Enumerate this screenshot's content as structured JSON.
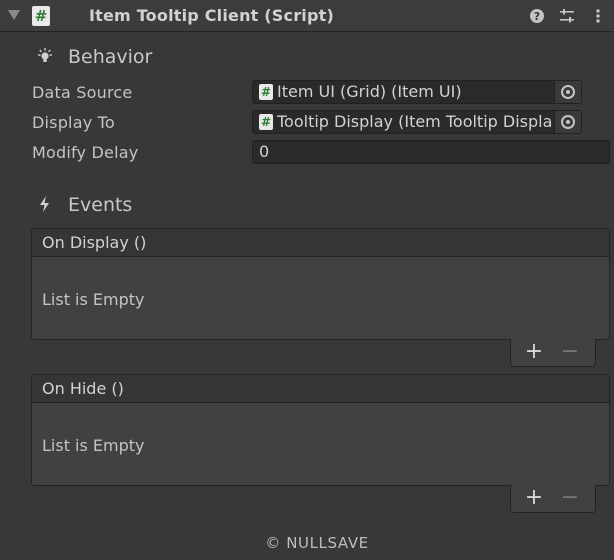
{
  "header": {
    "title": "Item Tooltip Client (Script)",
    "script_glyph": "#",
    "icons": [
      "help-icon",
      "presets-icon",
      "kebab-menu-icon"
    ]
  },
  "behavior": {
    "title": "Behavior",
    "icon": "lightbulb-icon",
    "properties": [
      {
        "label": "Data Source",
        "value": "Item UI (Grid) (Item UI)"
      },
      {
        "label": "Display To",
        "value": "Tooltip Display (Item Tooltip Displa"
      },
      {
        "label": "Modify Delay",
        "value": "0"
      }
    ]
  },
  "events": {
    "title": "Events",
    "icon": "lightning-icon",
    "lists": [
      {
        "header": "On Display ()",
        "empty_text": "List is Empty"
      },
      {
        "header": "On Hide ()",
        "empty_text": "List is Empty"
      }
    ],
    "plus": "+",
    "minus": "−"
  },
  "footer": {
    "copyright": "© NULLSAVE"
  },
  "colors": {
    "background": "#383838",
    "field": "#2a2a2a",
    "script_icon_fg": "#2e7d32"
  }
}
